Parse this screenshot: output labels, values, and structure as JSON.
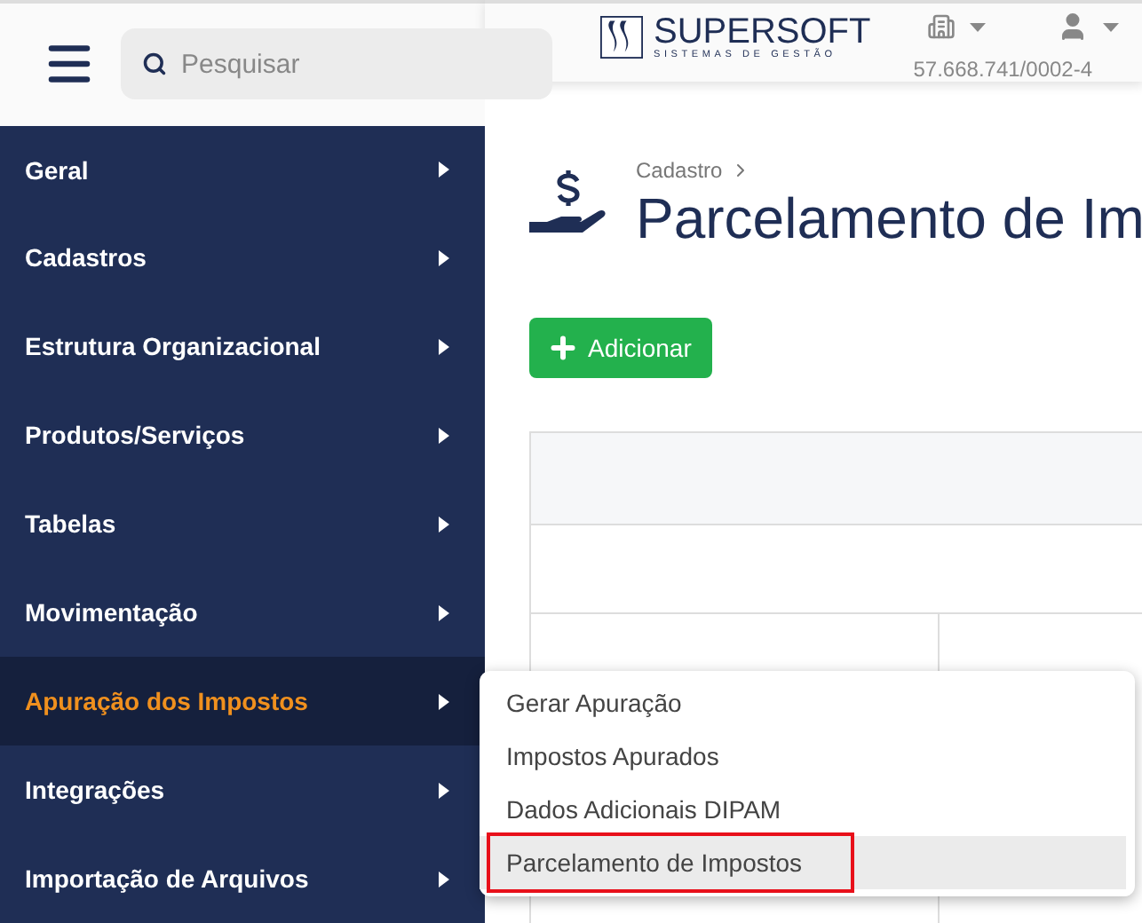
{
  "search": {
    "placeholder": "Pesquisar"
  },
  "sidebar": {
    "items": [
      {
        "label": "Geral",
        "selected": false
      },
      {
        "label": "Cadastros",
        "selected": false
      },
      {
        "label": "Estrutura Organizacional",
        "selected": false
      },
      {
        "label": "Produtos/Serviços",
        "selected": false
      },
      {
        "label": "Tabelas",
        "selected": false
      },
      {
        "label": "Movimentação",
        "selected": false
      },
      {
        "label": "Apuração dos Impostos",
        "selected": true
      },
      {
        "label": "Integrações",
        "selected": false
      },
      {
        "label": "Importação de Arquivos",
        "selected": false
      }
    ]
  },
  "header": {
    "logo_name": "SUPERSOFT",
    "logo_tagline": "SISTEMAS DE GESTÃO",
    "company_id": "57.668.741/0002-4"
  },
  "page": {
    "breadcrumb": "Cadastro",
    "title": "Parcelamento de Im",
    "add_button": "Adicionar"
  },
  "submenu": [
    {
      "label": "Gerar Apuração",
      "selected": false,
      "marked": false
    },
    {
      "label": "Impostos Apurados",
      "selected": false,
      "marked": false
    },
    {
      "label": "Dados Adicionais DIPAM",
      "selected": false,
      "marked": false
    },
    {
      "label": "Parcelamento de Impostos",
      "selected": true,
      "marked": true
    }
  ]
}
